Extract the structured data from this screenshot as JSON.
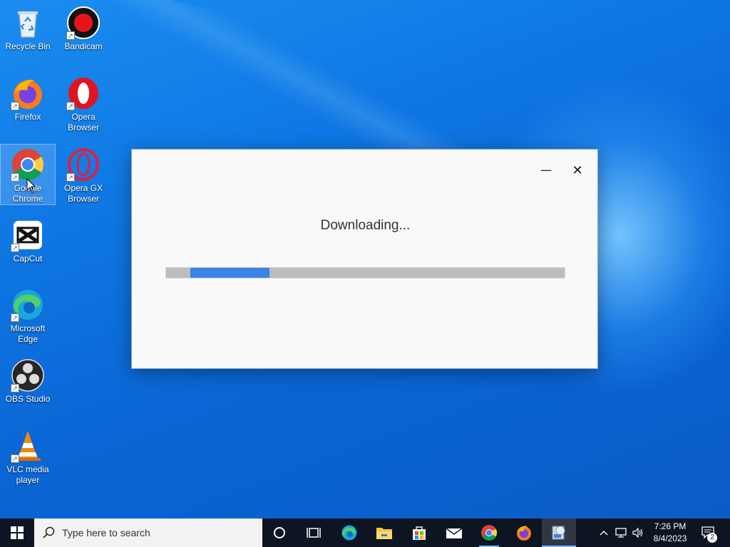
{
  "desktop": {
    "icons": [
      {
        "label_1": "Recycle Bin",
        "icon": "recycle-bin-icon"
      },
      {
        "label_1": "Bandicam",
        "icon": "bandicam-icon"
      },
      {
        "label_1": "Firefox",
        "icon": "firefox-icon"
      },
      {
        "label_1": "Opera",
        "label_2": "Browser",
        "icon": "opera-icon"
      },
      {
        "label_1": "Google",
        "label_2": "Chrome",
        "icon": "chrome-icon"
      },
      {
        "label_1": "Opera GX",
        "label_2": "Browser",
        "icon": "opera-gx-icon"
      },
      {
        "label_1": "CapCut",
        "icon": "capcut-icon"
      },
      {
        "label_1": "Microsoft",
        "label_2": "Edge",
        "icon": "edge-icon"
      },
      {
        "label_1": "OBS Studio",
        "icon": "obs-icon"
      },
      {
        "label_1": "VLC media",
        "label_2": "player",
        "icon": "vlc-icon"
      }
    ]
  },
  "dialog": {
    "title": "Downloading...",
    "minimize_glyph": "—",
    "close_glyph": "✕",
    "progress": {
      "start_fraction": 0.06,
      "end_fraction": 0.26,
      "indeterminate": true
    },
    "colors": {
      "fill": "#3a84e6",
      "track": "#bdbdbd"
    }
  },
  "taskbar": {
    "search_placeholder": "Type here to search",
    "apps": [
      "cortana-icon",
      "task-view-icon",
      "edge-icon",
      "file-explorer-icon",
      "store-icon",
      "mail-icon",
      "chrome-icon",
      "firefox-icon",
      "installer-icon"
    ],
    "clock": {
      "time": "7:26 PM",
      "date": "8/4/2023"
    },
    "notification_count": "2"
  },
  "colors": {
    "accent": "#0a6fd8",
    "taskbar": "#0c1521"
  }
}
